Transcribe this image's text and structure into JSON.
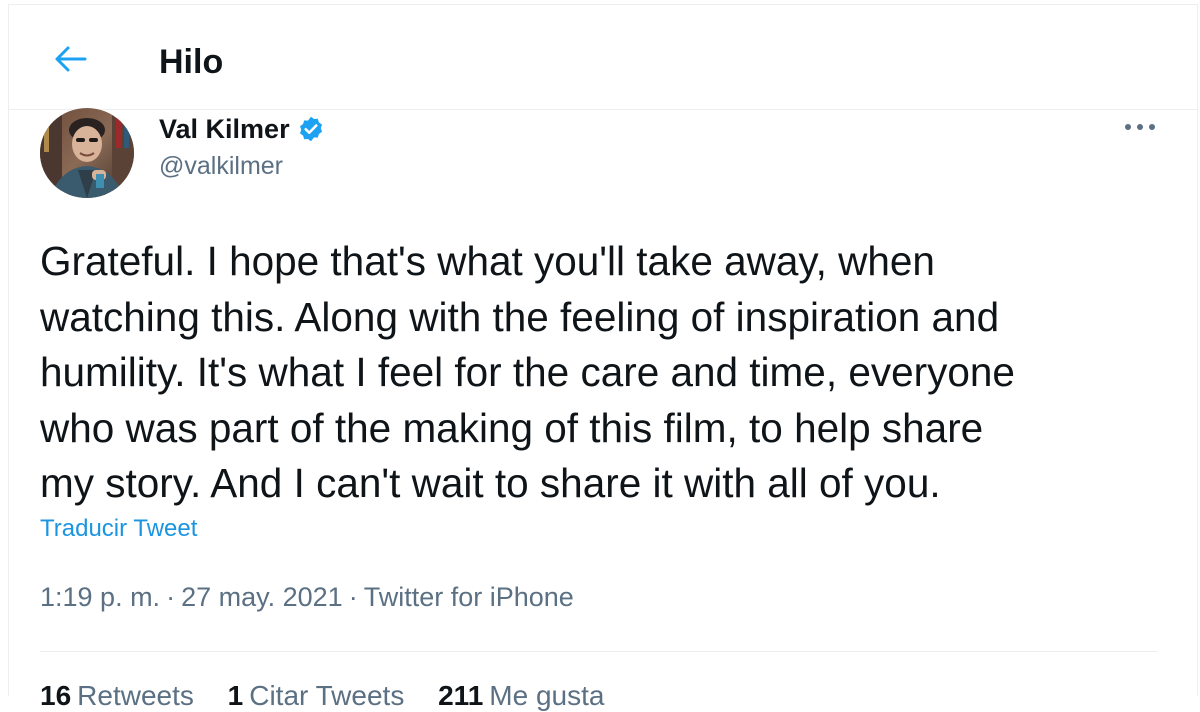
{
  "header": {
    "title": "Hilo"
  },
  "tweet": {
    "author": {
      "display_name": "Val Kilmer",
      "handle": "@valkilmer",
      "verified": true
    },
    "text": "Grateful. I hope that's what you'll take away, when\nwatching this. Along with the feeling of inspiration and\nhumility. It's what I feel for the care and time, everyone\nwho was part of the making of this film, to help share\nmy story. And I can't wait to share it with all of you.",
    "translate_label": "Traducir Tweet",
    "meta": {
      "time": "1:19 p. m.",
      "date": "27 may. 2021",
      "source": "Twitter for iPhone",
      "separator": "·"
    },
    "stats": [
      {
        "count": "16",
        "label": "Retweets"
      },
      {
        "count": "1",
        "label": "Citar Tweets"
      },
      {
        "count": "211",
        "label": "Me gusta"
      }
    ]
  },
  "colors": {
    "accent": "#1da1f2",
    "text_primary": "#0f1419",
    "text_secondary": "#5b7083",
    "border": "#eceff1"
  },
  "icons": {
    "back": "arrow-left-icon",
    "verified": "verified-badge-icon",
    "more": "more-horizontal-icon"
  }
}
